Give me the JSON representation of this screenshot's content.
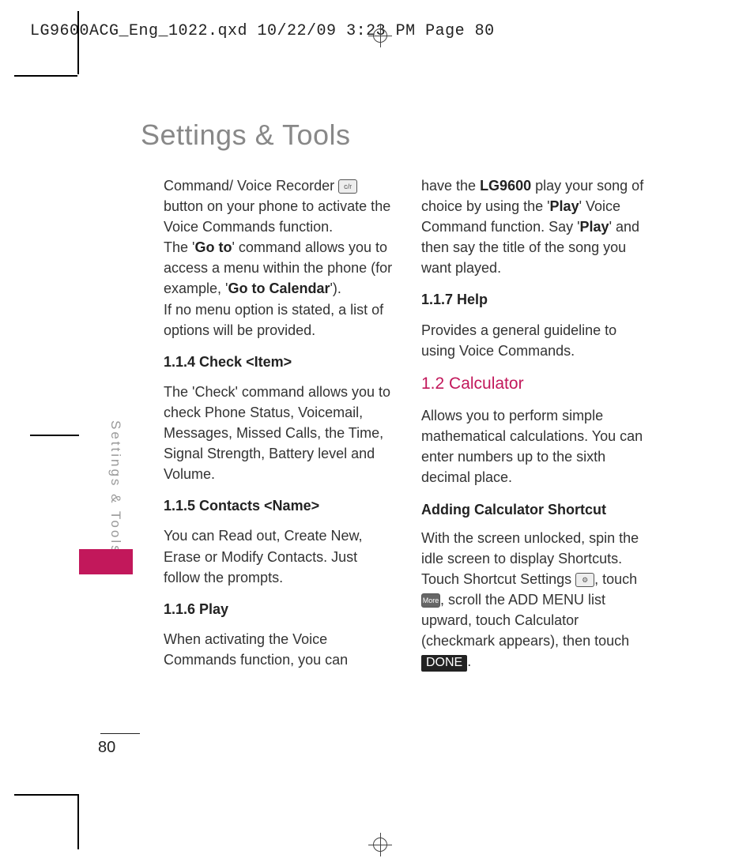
{
  "header": "LG9600ACG_Eng_1022.qxd  10/22/09  3:23 PM  Page 80",
  "page_title": "Settings & Tools",
  "side_label": "Settings & Tools",
  "page_number": "80",
  "done_label": "DONE",
  "col1": {
    "intro_1a": "Command/ Voice Recorder ",
    "intro_1b": " button on your phone to activate the Voice Commands function.",
    "intro_2a": "The '",
    "intro_2_go_to": "Go to",
    "intro_2b": "' command allows you to access a menu within the phone (for example, '",
    "intro_2_go_to_cal": "Go to Calendar",
    "intro_2c": "').",
    "intro_3": "If no menu option is stated, a list of options will be provided.",
    "h_114": "1.1.4 Check <Item>",
    "p_114": "The 'Check' command allows you to check Phone Status, Voicemail, Messages, Missed Calls, the Time, Signal Strength, Battery level and Volume.",
    "h_115": "1.1.5 Contacts <Name>",
    "p_115": "You can Read out, Create New, Erase or Modify Contacts. Just follow the prompts.",
    "h_116": "1.1.6 Play",
    "p_116": "When activating the Voice Commands function, you can"
  },
  "col2": {
    "p_116b_a": "have the ",
    "p_116b_model": "LG9600",
    "p_116b_b": " play your song of choice by using the '",
    "p_116b_play1": "Play",
    "p_116b_c": "' Voice Command function. Say '",
    "p_116b_play2": "Play",
    "p_116b_d": "' and then say the title of the song you want played.",
    "h_117": "1.1.7 Help",
    "p_117": "Provides a general guideline to using Voice Commands.",
    "h_12": "1.2 Calculator",
    "p_12": "Allows you to perform simple mathematical calculations. You can enter numbers up to the sixth decimal place.",
    "sub_add": "Adding Calculator Shortcut",
    "p_add_a": "With the screen unlocked, spin the idle screen to display Shortcuts. Touch Shortcut Settings ",
    "p_add_b": ", touch ",
    "p_add_c": ", scroll the ADD MENU list upward, touch Calculator (checkmark appears), then touch ",
    "p_add_d": "."
  }
}
